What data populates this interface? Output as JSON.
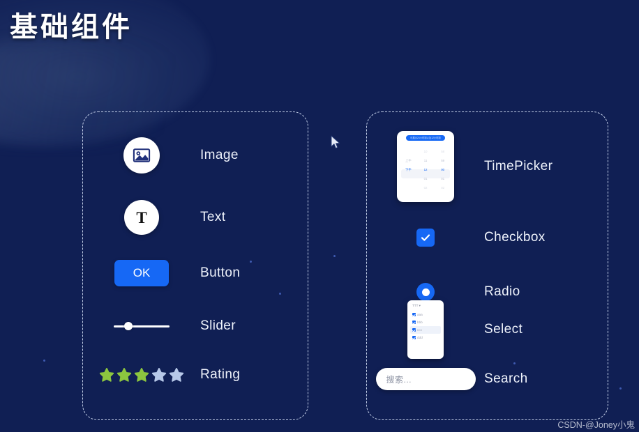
{
  "page": {
    "title": "基础组件",
    "background_color": "#101f54",
    "accent_color": "#1668f5",
    "watermark": "CSDN-@Joney小鬼"
  },
  "panels": {
    "left": {
      "name": "basic-components-left",
      "rows": [
        {
          "label": "Image",
          "widget": "image-icon"
        },
        {
          "label": "Text",
          "widget": "text-icon",
          "glyph": "T"
        },
        {
          "label": "Button",
          "widget": "button",
          "button_label": "OK"
        },
        {
          "label": "Slider",
          "widget": "slider",
          "value": 30
        },
        {
          "label": "Rating",
          "widget": "rating",
          "value": 3,
          "max": 5,
          "filled_color": "#8cc63f",
          "empty_color": "#b7c8e8"
        }
      ]
    },
    "right": {
      "name": "basic-components-right",
      "rows": [
        {
          "label": "TimePicker",
          "widget": "timepicker"
        },
        {
          "label": "Checkbox",
          "widget": "checkbox",
          "checked": true
        },
        {
          "label": "Radio",
          "widget": "radio",
          "selected": true
        },
        {
          "label": "Select",
          "widget": "select"
        },
        {
          "label": "Search",
          "widget": "search"
        }
      ]
    }
  },
  "timepicker": {
    "header_pill": "可展示24小时制以及12小时制",
    "columns": {
      "meridiem": [
        "",
        "上午",
        "下午",
        "",
        ""
      ],
      "hour": [
        "10",
        "11",
        "12",
        "01",
        "02"
      ],
      "minute": [
        "58",
        "59",
        "00",
        "01",
        "02"
      ]
    },
    "selected_index": 2
  },
  "select": {
    "header": "TTT ▾",
    "options": [
      {
        "label": "aaa",
        "checked": true,
        "active": false
      },
      {
        "label": "bbb",
        "checked": true,
        "active": false
      },
      {
        "label": "ccc",
        "checked": true,
        "active": true
      },
      {
        "label": "ddd",
        "checked": true,
        "active": false
      }
    ]
  },
  "search": {
    "placeholder": "搜索...",
    "value": ""
  }
}
